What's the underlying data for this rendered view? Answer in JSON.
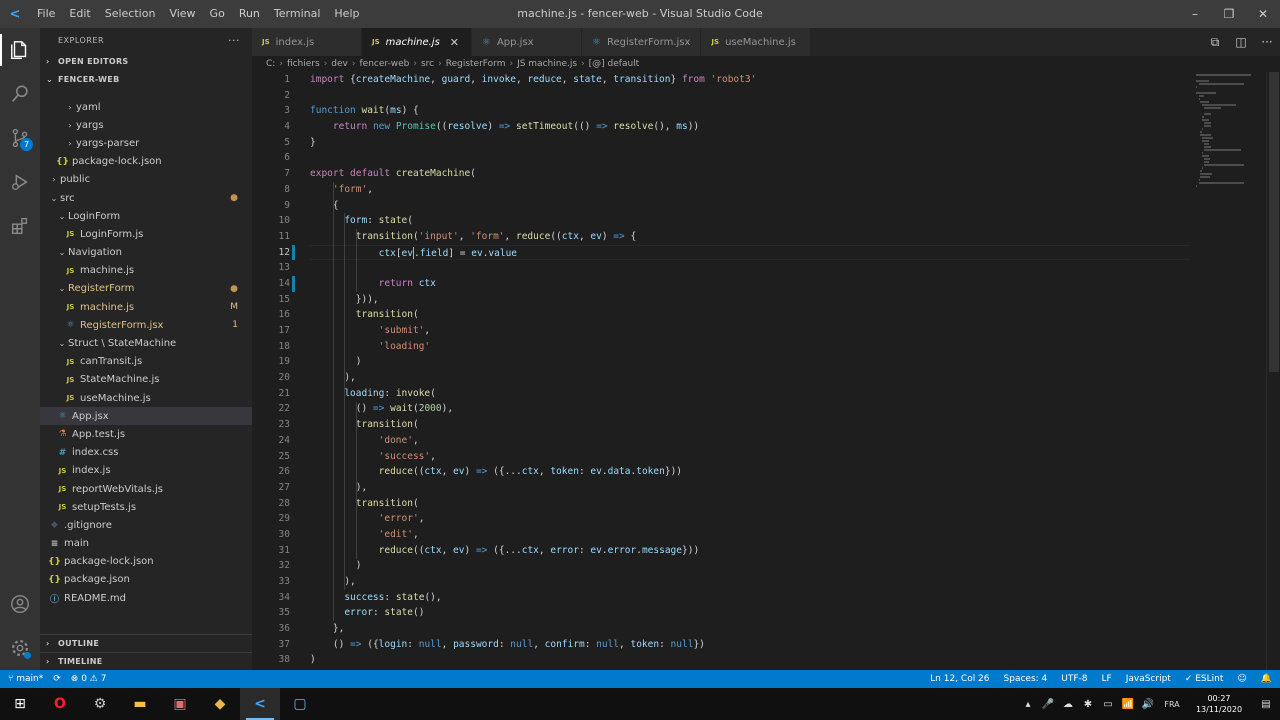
{
  "titlebar": {
    "logo": "<",
    "menu": [
      "File",
      "Edit",
      "Selection",
      "View",
      "Go",
      "Run",
      "Terminal",
      "Help"
    ],
    "title": "machine.js - fencer-web - Visual Studio Code",
    "controls": [
      "–",
      "❐",
      "✕"
    ]
  },
  "activitybar": {
    "scm_badge": "7"
  },
  "sidebar": {
    "header": "EXPLORER",
    "header_more": "···",
    "open_editors": "OPEN EDITORS",
    "root": "FENCER-WEB",
    "tree": [
      {
        "indent": 2,
        "type": "folder",
        "label": "yaml",
        "open": false,
        "color": "#cccccc"
      },
      {
        "indent": 2,
        "type": "folder",
        "label": "yargs",
        "open": false,
        "color": "#cccccc"
      },
      {
        "indent": 2,
        "type": "folder",
        "label": "yargs-parser",
        "open": false,
        "color": "#cccccc"
      },
      {
        "indent": 1,
        "type": "file",
        "label": "package-lock.json",
        "icon": "{}",
        "iconColor": "#cbcb41",
        "color": "#cccccc"
      },
      {
        "indent": 0,
        "type": "folder",
        "label": "public",
        "open": false,
        "color": "#cccccc"
      },
      {
        "indent": 0,
        "type": "folder",
        "label": "src",
        "open": true,
        "color": "#cccccc",
        "mark": "●",
        "markColor": "#c09553"
      },
      {
        "indent": 1,
        "type": "folder",
        "label": "LoginForm",
        "open": true,
        "color": "#cccccc"
      },
      {
        "indent": 2,
        "type": "file",
        "label": "LoginForm.js",
        "icon": "JS",
        "iconColor": "#cbcb41",
        "color": "#cccccc"
      },
      {
        "indent": 1,
        "type": "folder",
        "label": "Navigation",
        "open": true,
        "color": "#cccccc"
      },
      {
        "indent": 2,
        "type": "file",
        "label": "machine.js",
        "icon": "JS",
        "iconColor": "#cbcb41",
        "color": "#cccccc"
      },
      {
        "indent": 1,
        "type": "folder",
        "label": "RegisterForm",
        "open": true,
        "color": "#e2c08d",
        "mark": "●",
        "markColor": "#c09553"
      },
      {
        "indent": 2,
        "type": "file",
        "label": "machine.js",
        "icon": "JS",
        "iconColor": "#cbcb41",
        "color": "#e2c08d",
        "mark": "M",
        "markColor": "#e2c08d"
      },
      {
        "indent": 2,
        "type": "file",
        "label": "RegisterForm.jsx",
        "icon": "⚛",
        "iconColor": "#519aba",
        "color": "#e2c08d",
        "mark": "1",
        "markColor": "#e2c08d"
      },
      {
        "indent": 1,
        "type": "folder",
        "label": "Struct \\ StateMachine",
        "open": true,
        "color": "#cccccc"
      },
      {
        "indent": 2,
        "type": "file",
        "label": "canTransit.js",
        "icon": "JS",
        "iconColor": "#cbcb41",
        "color": "#cccccc"
      },
      {
        "indent": 2,
        "type": "file",
        "label": "StateMachine.js",
        "icon": "JS",
        "iconColor": "#cbcb41",
        "color": "#cccccc"
      },
      {
        "indent": 2,
        "type": "file",
        "label": "useMachine.js",
        "icon": "JS",
        "iconColor": "#cbcb41",
        "color": "#cccccc"
      },
      {
        "indent": 1,
        "type": "file",
        "label": "App.jsx",
        "icon": "⚛",
        "iconColor": "#519aba",
        "color": "#cccccc",
        "selected": true
      },
      {
        "indent": 1,
        "type": "file",
        "label": "App.test.js",
        "icon": "⚗",
        "iconColor": "#e37933",
        "color": "#cccccc"
      },
      {
        "indent": 1,
        "type": "file",
        "label": "index.css",
        "icon": "#",
        "iconColor": "#519aba",
        "color": "#cccccc"
      },
      {
        "indent": 1,
        "type": "file",
        "label": "index.js",
        "icon": "JS",
        "iconColor": "#cbcb41",
        "color": "#cccccc"
      },
      {
        "indent": 1,
        "type": "file",
        "label": "reportWebVitals.js",
        "icon": "JS",
        "iconColor": "#cbcb41",
        "color": "#cccccc"
      },
      {
        "indent": 1,
        "type": "file",
        "label": "setupTests.js",
        "icon": "JS",
        "iconColor": "#cbcb41",
        "color": "#cccccc"
      },
      {
        "indent": 0,
        "type": "file",
        "label": ".gitignore",
        "icon": "◆",
        "iconColor": "#41535b",
        "color": "#cccccc"
      },
      {
        "indent": 0,
        "type": "file",
        "label": "main",
        "icon": "≡",
        "iconColor": "#cccccc",
        "color": "#cccccc"
      },
      {
        "indent": 0,
        "type": "file",
        "label": "package-lock.json",
        "icon": "{}",
        "iconColor": "#cbcb41",
        "color": "#cccccc"
      },
      {
        "indent": 0,
        "type": "file",
        "label": "package.json",
        "icon": "{}",
        "iconColor": "#cbcb41",
        "color": "#cccccc"
      },
      {
        "indent": 0,
        "type": "file",
        "label": "README.md",
        "icon": "ⓘ",
        "iconColor": "#519aba",
        "color": "#cccccc"
      }
    ],
    "outline": "OUTLINE",
    "timeline": "TIMELINE"
  },
  "tabs": [
    {
      "label": "index.js",
      "icon": "JS",
      "iconColor": "#cbcb41",
      "active": false
    },
    {
      "label": "machine.js",
      "icon": "JS",
      "iconColor": "#cbcb41",
      "active": true,
      "close": "✕"
    },
    {
      "label": "App.jsx",
      "icon": "⚛",
      "iconColor": "#519aba",
      "active": false
    },
    {
      "label": "RegisterForm.jsx",
      "icon": "⚛",
      "iconColor": "#519aba",
      "active": false
    },
    {
      "label": "useMachine.js",
      "icon": "JS",
      "iconColor": "#cbcb41",
      "active": false
    }
  ],
  "editor_actions": [
    "⧉",
    "◫",
    "···"
  ],
  "breadcrumb": [
    "C:",
    "fichiers",
    "dev",
    "fencer-web",
    "src",
    "RegisterForm",
    "JS machine.js",
    "[@] default"
  ],
  "code": {
    "current_line": 12,
    "modified_lines": [
      12,
      14
    ],
    "lines": [
      [
        [
          "kw",
          "import "
        ],
        [
          "pun",
          "{"
        ],
        [
          "var",
          "createMachine"
        ],
        [
          "pun",
          ", "
        ],
        [
          "var",
          "guard"
        ],
        [
          "pun",
          ", "
        ],
        [
          "var",
          "invoke"
        ],
        [
          "pun",
          ", "
        ],
        [
          "var",
          "reduce"
        ],
        [
          "pun",
          ", "
        ],
        [
          "var",
          "state"
        ],
        [
          "pun",
          ", "
        ],
        [
          "var",
          "transition"
        ],
        [
          "pun",
          "} "
        ],
        [
          "kw",
          "from "
        ],
        [
          "str",
          "'robot3'"
        ]
      ],
      [],
      [
        [
          "kb",
          "function "
        ],
        [
          "fn",
          "wait"
        ],
        [
          "pun",
          "("
        ],
        [
          "var",
          "ms"
        ],
        [
          "pun",
          ") {"
        ]
      ],
      [
        [
          "pun",
          "    "
        ],
        [
          "kw",
          "return "
        ],
        [
          "kb",
          "new "
        ],
        [
          "cls",
          "Promise"
        ],
        [
          "pun",
          "(("
        ],
        [
          "var",
          "resolve"
        ],
        [
          "pun",
          ") "
        ],
        [
          "kb",
          "=>"
        ],
        [
          "pun",
          " "
        ],
        [
          "fn",
          "setTimeout"
        ],
        [
          "pun",
          "(() "
        ],
        [
          "kb",
          "=>"
        ],
        [
          "pun",
          " "
        ],
        [
          "fn",
          "resolve"
        ],
        [
          "pun",
          "(), "
        ],
        [
          "var",
          "ms"
        ],
        [
          "pun",
          "))"
        ]
      ],
      [
        [
          "pun",
          "}"
        ]
      ],
      [],
      [
        [
          "kw",
          "export "
        ],
        [
          "kw",
          "default "
        ],
        [
          "fn",
          "createMachine"
        ],
        [
          "pun",
          "("
        ]
      ],
      [
        [
          "pun",
          "    "
        ],
        [
          "str",
          "'form'"
        ],
        [
          "pun",
          ","
        ]
      ],
      [
        [
          "pun",
          "    {"
        ]
      ],
      [
        [
          "pun",
          "      "
        ],
        [
          "var",
          "form"
        ],
        [
          "pun",
          ": "
        ],
        [
          "fn",
          "state"
        ],
        [
          "pun",
          "("
        ]
      ],
      [
        [
          "pun",
          "        "
        ],
        [
          "fn",
          "transition"
        ],
        [
          "pun",
          "("
        ],
        [
          "str",
          "'input'"
        ],
        [
          "pun",
          ", "
        ],
        [
          "str",
          "'form'"
        ],
        [
          "pun",
          ", "
        ],
        [
          "fn",
          "reduce"
        ],
        [
          "pun",
          "(("
        ],
        [
          "var",
          "ctx"
        ],
        [
          "pun",
          ", "
        ],
        [
          "var",
          "ev"
        ],
        [
          "pun",
          ") "
        ],
        [
          "kb",
          "=>"
        ],
        [
          "pun",
          " {"
        ]
      ],
      [
        [
          "pun",
          "            "
        ],
        [
          "var",
          "ctx"
        ],
        [
          "pun",
          "["
        ],
        [
          "var",
          "ev"
        ],
        [
          "pun",
          "."
        ],
        [
          "var",
          "field"
        ],
        [
          "pun",
          "] = "
        ],
        [
          "var",
          "ev"
        ],
        [
          "pun",
          "."
        ],
        [
          "var",
          "value"
        ]
      ],
      [],
      [
        [
          "pun",
          "            "
        ],
        [
          "kw",
          "return "
        ],
        [
          "var",
          "ctx"
        ]
      ],
      [
        [
          "pun",
          "        }))"
        ],
        [
          "pun",
          ","
        ]
      ],
      [
        [
          "pun",
          "        "
        ],
        [
          "fn",
          "transition"
        ],
        [
          "pun",
          "("
        ]
      ],
      [
        [
          "pun",
          "            "
        ],
        [
          "str",
          "'submit'"
        ],
        [
          "pun",
          ","
        ]
      ],
      [
        [
          "pun",
          "            "
        ],
        [
          "str",
          "'loading'"
        ]
      ],
      [
        [
          "pun",
          "        )"
        ]
      ],
      [
        [
          "pun",
          "      ),"
        ]
      ],
      [
        [
          "pun",
          "      "
        ],
        [
          "var",
          "loading"
        ],
        [
          "pun",
          ": "
        ],
        [
          "fn",
          "invoke"
        ],
        [
          "pun",
          "("
        ]
      ],
      [
        [
          "pun",
          "        () "
        ],
        [
          "kb",
          "=>"
        ],
        [
          "pun",
          " "
        ],
        [
          "fn",
          "wait"
        ],
        [
          "pun",
          "("
        ],
        [
          "num",
          "2000"
        ],
        [
          "pun",
          "),"
        ]
      ],
      [
        [
          "pun",
          "        "
        ],
        [
          "fn",
          "transition"
        ],
        [
          "pun",
          "("
        ]
      ],
      [
        [
          "pun",
          "            "
        ],
        [
          "str",
          "'done'"
        ],
        [
          "pun",
          ","
        ]
      ],
      [
        [
          "pun",
          "            "
        ],
        [
          "str",
          "'success'"
        ],
        [
          "pun",
          ","
        ]
      ],
      [
        [
          "pun",
          "            "
        ],
        [
          "fn",
          "reduce"
        ],
        [
          "pun",
          "(("
        ],
        [
          "var",
          "ctx"
        ],
        [
          "pun",
          ", "
        ],
        [
          "var",
          "ev"
        ],
        [
          "pun",
          ") "
        ],
        [
          "kb",
          "=>"
        ],
        [
          "pun",
          " ({..."
        ],
        [
          "var",
          "ctx"
        ],
        [
          "pun",
          ", "
        ],
        [
          "var",
          "token"
        ],
        [
          "pun",
          ": "
        ],
        [
          "var",
          "ev"
        ],
        [
          "pun",
          "."
        ],
        [
          "var",
          "data"
        ],
        [
          "pun",
          "."
        ],
        [
          "var",
          "token"
        ],
        [
          "pun",
          "}))"
        ]
      ],
      [
        [
          "pun",
          "        ),"
        ]
      ],
      [
        [
          "pun",
          "        "
        ],
        [
          "fn",
          "transition"
        ],
        [
          "pun",
          "("
        ]
      ],
      [
        [
          "pun",
          "            "
        ],
        [
          "str",
          "'error'"
        ],
        [
          "pun",
          ","
        ]
      ],
      [
        [
          "pun",
          "            "
        ],
        [
          "str",
          "'edit'"
        ],
        [
          "pun",
          ","
        ]
      ],
      [
        [
          "pun",
          "            "
        ],
        [
          "fn",
          "reduce"
        ],
        [
          "pun",
          "(("
        ],
        [
          "var",
          "ctx"
        ],
        [
          "pun",
          ", "
        ],
        [
          "var",
          "ev"
        ],
        [
          "pun",
          ") "
        ],
        [
          "kb",
          "=>"
        ],
        [
          "pun",
          " ({..."
        ],
        [
          "var",
          "ctx"
        ],
        [
          "pun",
          ", "
        ],
        [
          "var",
          "error"
        ],
        [
          "pun",
          ": "
        ],
        [
          "var",
          "ev"
        ],
        [
          "pun",
          "."
        ],
        [
          "var",
          "error"
        ],
        [
          "pun",
          "."
        ],
        [
          "var",
          "message"
        ],
        [
          "pun",
          "}))"
        ]
      ],
      [
        [
          "pun",
          "        )"
        ]
      ],
      [
        [
          "pun",
          "      ),"
        ]
      ],
      [
        [
          "pun",
          "      "
        ],
        [
          "var",
          "success"
        ],
        [
          "pun",
          ": "
        ],
        [
          "fn",
          "state"
        ],
        [
          "pun",
          "(),"
        ]
      ],
      [
        [
          "pun",
          "      "
        ],
        [
          "var",
          "error"
        ],
        [
          "pun",
          ": "
        ],
        [
          "fn",
          "state"
        ],
        [
          "pun",
          "()"
        ]
      ],
      [
        [
          "pun",
          "    },"
        ]
      ],
      [
        [
          "pun",
          "    () "
        ],
        [
          "kb",
          "=>"
        ],
        [
          "pun",
          " ({"
        ],
        [
          "var",
          "login"
        ],
        [
          "pun",
          ": "
        ],
        [
          "kb",
          "null"
        ],
        [
          "pun",
          ", "
        ],
        [
          "var",
          "password"
        ],
        [
          "pun",
          ": "
        ],
        [
          "kb",
          "null"
        ],
        [
          "pun",
          ", "
        ],
        [
          "var",
          "confirm"
        ],
        [
          "pun",
          ": "
        ],
        [
          "kb",
          "null"
        ],
        [
          "pun",
          ", "
        ],
        [
          "var",
          "token"
        ],
        [
          "pun",
          ": "
        ],
        [
          "kb",
          "null"
        ],
        [
          "pun",
          "})"
        ]
      ],
      [
        [
          "pun",
          ")"
        ]
      ]
    ]
  },
  "statusbar": {
    "branch": "⑂ main*",
    "sync": "⟳",
    "problems": "⊗ 0 ⚠ 7",
    "position": "Ln 12, Col 26",
    "spaces": "Spaces: 4",
    "encoding": "UTF-8",
    "eol": "LF",
    "language": "JavaScript",
    "eslint": "✓ ESLint",
    "feedback": "☺",
    "bell": "🔔"
  },
  "taskbar": {
    "apps": [
      {
        "name": "start",
        "glyph": "⊞",
        "color": "#ffffff"
      },
      {
        "name": "opera",
        "glyph": "O",
        "color": "#ff1b2d"
      },
      {
        "name": "settings",
        "glyph": "⚙",
        "color": "#cccccc"
      },
      {
        "name": "explorer",
        "glyph": "▬",
        "color": "#f3c142"
      },
      {
        "name": "photos",
        "glyph": "▣",
        "color": "#e06c6c"
      },
      {
        "name": "git-kraken",
        "glyph": "◆",
        "color": "#e9b44c"
      },
      {
        "name": "vscode",
        "glyph": "<",
        "color": "#3ea6ff",
        "active": true
      },
      {
        "name": "window-app",
        "glyph": "▢",
        "color": "#5fb4e6"
      }
    ],
    "tray": [
      "▴",
      "🎤",
      "☁",
      "✱",
      "▭",
      "📶",
      "🔊",
      "FRA"
    ],
    "time": "00:27",
    "date": "13/11/2020",
    "notif": "▤"
  }
}
